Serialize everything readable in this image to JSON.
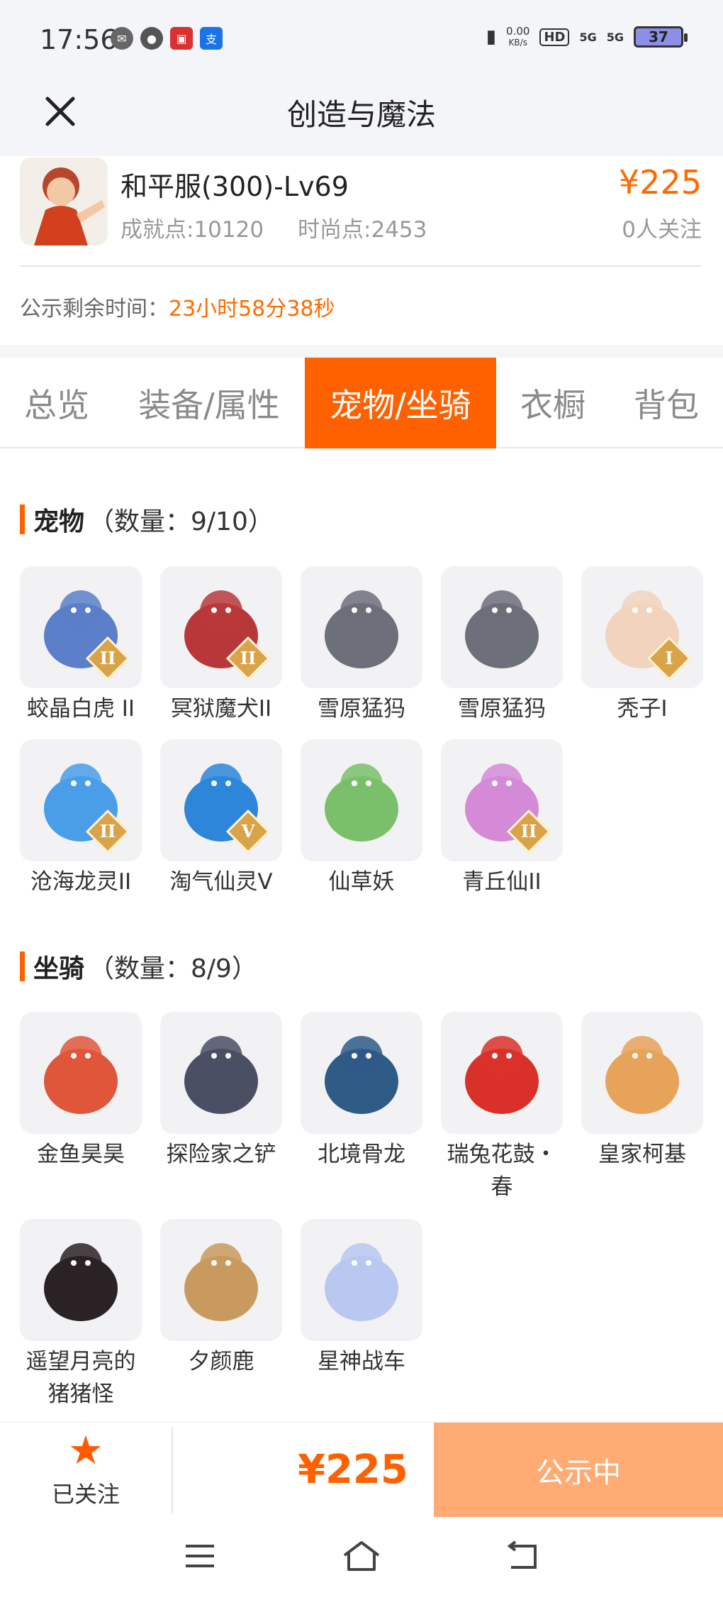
{
  "status_bar": {
    "time": "17:56",
    "net_speed": "0.00",
    "net_unit": "KB/s",
    "hd": "HD",
    "sig1": "5G",
    "sig2": "5G",
    "battery": "37"
  },
  "header": {
    "title": "创造与魔法"
  },
  "item": {
    "name": "和平服(300)-Lv69",
    "achievement": "成就点:10120",
    "fashion": "时尚点:2453",
    "price": "¥225",
    "followers": "0人关注"
  },
  "remaining": {
    "label": "公示剩余时间：",
    "time": "23小时58分38秒"
  },
  "tabs": [
    "总览",
    "装备/属性",
    "宠物/坐骑",
    "衣橱",
    "背包"
  ],
  "pets": {
    "title": "宠物",
    "count": "（数量：9/10）",
    "items": [
      {
        "name": "蛟晶白虎 II",
        "badge": "II",
        "icon": "white-tiger-icon",
        "color": "#5b7fc8"
      },
      {
        "name": "冥狱魔犬II",
        "badge": "II",
        "icon": "hell-hound-icon",
        "color": "#b8383a"
      },
      {
        "name": "雪原猛犸",
        "badge": "",
        "icon": "mammoth-icon",
        "color": "#6d6f7a"
      },
      {
        "name": "雪原猛犸",
        "badge": "",
        "icon": "mammoth-icon",
        "color": "#6d6f7a"
      },
      {
        "name": "秃子I",
        "badge": "I",
        "icon": "bald-kid-icon",
        "color": "#f2d3bd"
      },
      {
        "name": "沧海龙灵II",
        "badge": "II",
        "icon": "sea-dragon-spirit-icon",
        "color": "#4a9ee8"
      },
      {
        "name": "淘气仙灵V",
        "badge": "V",
        "icon": "naughty-spirit-icon",
        "color": "#2d86d9"
      },
      {
        "name": "仙草妖",
        "badge": "",
        "icon": "herb-fairy-icon",
        "color": "#7ac06a"
      },
      {
        "name": "青丘仙II",
        "badge": "II",
        "icon": "fox-fairy-icon",
        "color": "#d58ad8"
      }
    ]
  },
  "mounts": {
    "title": "坐骑",
    "count": "（数量：8/9）",
    "items": [
      {
        "name": "金鱼昊昊",
        "icon": "goldfish-icon",
        "color": "#e0563a"
      },
      {
        "name": "探险家之铲",
        "icon": "shovel-icon",
        "color": "#4a4f63"
      },
      {
        "name": "北境骨龙",
        "icon": "bone-dragon-icon",
        "color": "#2f5b87"
      },
      {
        "name": "瑞兔花鼓・春",
        "line1": "瑞兔花鼓・",
        "line2": "春",
        "icon": "rabbit-drum-icon",
        "color": "#d9312a"
      },
      {
        "name": "皇家柯基",
        "icon": "royal-corgi-icon",
        "color": "#e8a35a"
      },
      {
        "name": "遥望月亮的猪猪怪",
        "line1": "遥望月亮的",
        "line2": "猪猪怪",
        "icon": "moon-pig-icon",
        "color": "#2b2226"
      },
      {
        "name": "夕颜鹿",
        "icon": "deer-icon",
        "color": "#c89a5e"
      },
      {
        "name": "星神战车",
        "icon": "star-chariot-icon",
        "color": "#b9c8f0"
      }
    ]
  },
  "bottom": {
    "follow_label": "已关注",
    "price": "¥225",
    "action": "公示中"
  },
  "colors": {
    "accent": "#ff6000",
    "price": "#ff6a00",
    "action_bg": "#ffab73"
  }
}
